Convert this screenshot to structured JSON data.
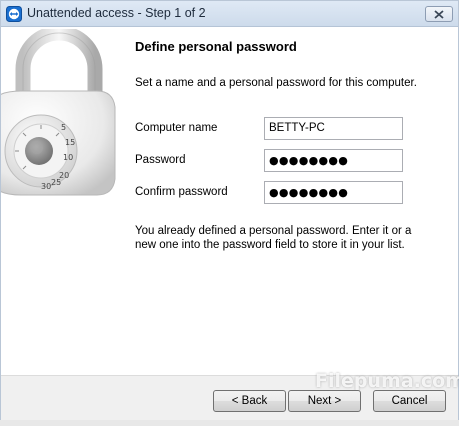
{
  "window": {
    "title": "Unattended access - Step 1 of 2"
  },
  "content": {
    "heading": "Define personal password",
    "intro": "Set a name and a personal password for this computer.",
    "fields": [
      {
        "label": "Computer name",
        "value": "BETTY-PC"
      },
      {
        "label": "Password",
        "value": "●●●●●●●●"
      },
      {
        "label": "Confirm password",
        "value": "●●●●●●●●"
      }
    ],
    "info_line1": "You already defined a personal password. Enter it or a",
    "info_line2": "new one into the password field to store it in your list."
  },
  "footer": {
    "back_label": "< Back",
    "next_label": "Next >",
    "cancel_label": "Cancel"
  },
  "watermark": "Filepuma.com",
  "padlock_dial_numbers": [
    "10",
    "20",
    "30",
    "5",
    "15",
    "25"
  ],
  "colors": {
    "titlebar": "#d6e3f1",
    "brand_icon": "#1a6fd0"
  }
}
